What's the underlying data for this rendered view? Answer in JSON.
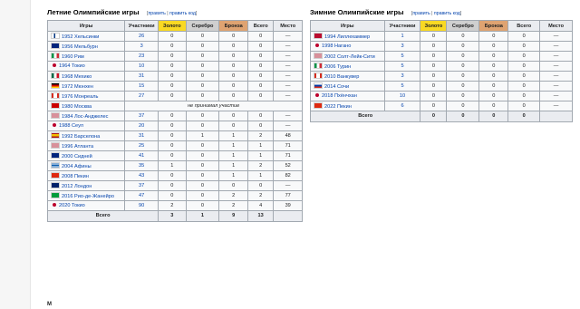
{
  "summer": {
    "title": "Летние Олимпийские игры",
    "edit_open": "[",
    "edit": "править",
    "edit_sep": " | ",
    "edit_code": "править код",
    "edit_close": "]",
    "headers": [
      "Игры",
      "Участники",
      "Золото",
      "Серебро",
      "Бронза",
      "Всего",
      "Место"
    ],
    "rows": [
      {
        "games": "1952 Хельсинки",
        "flag": "fi",
        "part": "26",
        "g": "0",
        "s": "0",
        "b": "0",
        "tot": "0",
        "place": "—"
      },
      {
        "games": "1956 Мельбурн",
        "flag": "au",
        "part": "3",
        "g": "0",
        "s": "0",
        "b": "0",
        "tot": "0",
        "place": "—"
      },
      {
        "games": "1960 Рим",
        "flag": "it",
        "part": "23",
        "g": "0",
        "s": "0",
        "b": "0",
        "tot": "0",
        "place": "—"
      },
      {
        "games": "1964 Токио",
        "flag": "jp",
        "part": "10",
        "g": "0",
        "s": "0",
        "b": "0",
        "tot": "0",
        "place": "—"
      },
      {
        "games": "1968 Мехико",
        "flag": "mx",
        "part": "31",
        "g": "0",
        "s": "0",
        "b": "0",
        "tot": "0",
        "place": "—"
      },
      {
        "games": "1972 Мюнхен",
        "flag": "de",
        "part": "15",
        "g": "0",
        "s": "0",
        "b": "0",
        "tot": "0",
        "place": "—"
      },
      {
        "games": "1976 Монреаль",
        "flag": "ca",
        "part": "27",
        "g": "0",
        "s": "0",
        "b": "0",
        "tot": "0",
        "place": "—"
      },
      {
        "games": "1980 Москва",
        "flag": "su",
        "np": "не принимал участие"
      },
      {
        "games": "1984 Лос-Анджелес",
        "flag": "us",
        "part": "37",
        "g": "0",
        "s": "0",
        "b": "0",
        "tot": "0",
        "place": "—"
      },
      {
        "games": "1988 Сеул",
        "flag": "kr",
        "part": "20",
        "g": "0",
        "s": "0",
        "b": "0",
        "tot": "0",
        "place": "—"
      },
      {
        "games": "1992 Барселона",
        "flag": "es",
        "part": "31",
        "g": "0",
        "s": "1",
        "b": "1",
        "tot": "2",
        "place": "48"
      },
      {
        "games": "1996 Атланта",
        "flag": "us",
        "part": "25",
        "g": "0",
        "s": "0",
        "b": "1",
        "tot": "1",
        "place": "71"
      },
      {
        "games": "2000 Сидней",
        "flag": "au",
        "part": "41",
        "g": "0",
        "s": "0",
        "b": "1",
        "tot": "1",
        "place": "71"
      },
      {
        "games": "2004 Афины",
        "flag": "gr",
        "part": "35",
        "g": "1",
        "s": "0",
        "b": "1",
        "tot": "2",
        "place": "52"
      },
      {
        "games": "2008 Пекин",
        "flag": "cn",
        "part": "43",
        "g": "0",
        "s": "0",
        "b": "1",
        "tot": "1",
        "place": "82"
      },
      {
        "games": "2012 Лондон",
        "flag": "gb",
        "part": "37",
        "g": "0",
        "s": "0",
        "b": "0",
        "tot": "0",
        "place": "—"
      },
      {
        "games": "2016 Рио-де-Жанейро",
        "flag": "br",
        "part": "47",
        "g": "0",
        "s": "0",
        "b": "2",
        "tot": "2",
        "place": "77"
      },
      {
        "games": "2020 Токио",
        "flag": "jp",
        "part": "90",
        "g": "2",
        "s": "0",
        "b": "2",
        "tot": "4",
        "place": "39"
      }
    ],
    "total": {
      "label": "Всего",
      "g": "3",
      "s": "1",
      "b": "9",
      "tot": "13",
      "place": ""
    }
  },
  "winter": {
    "title": "Зимние Олимпийские игры",
    "edit_open": "[",
    "edit": "править",
    "edit_sep": " | ",
    "edit_code": "править код",
    "edit_close": "]",
    "headers": [
      "Игры",
      "Участники",
      "Золото",
      "Серебро",
      "Бронза",
      "Всего",
      "Место"
    ],
    "rows": [
      {
        "games": "1994 Лиллехаммер",
        "flag": "no",
        "part": "1",
        "g": "0",
        "s": "0",
        "b": "0",
        "tot": "0",
        "place": "—"
      },
      {
        "games": "1998 Нагано",
        "flag": "jp",
        "part": "3",
        "g": "0",
        "s": "0",
        "b": "0",
        "tot": "0",
        "place": "—"
      },
      {
        "games": "2002 Солт-Лейк-Сити",
        "flag": "us",
        "part": "5",
        "g": "0",
        "s": "0",
        "b": "0",
        "tot": "0",
        "place": "—"
      },
      {
        "games": "2006 Турин",
        "flag": "it",
        "part": "5",
        "g": "0",
        "s": "0",
        "b": "0",
        "tot": "0",
        "place": "—"
      },
      {
        "games": "2010 Ванкувер",
        "flag": "ca",
        "part": "3",
        "g": "0",
        "s": "0",
        "b": "0",
        "tot": "0",
        "place": "—"
      },
      {
        "games": "2014 Сочи",
        "flag": "ru",
        "part": "5",
        "g": "0",
        "s": "0",
        "b": "0",
        "tot": "0",
        "place": "—"
      },
      {
        "games": "2018 Пхёнчхан",
        "flag": "kr",
        "part": "10",
        "g": "0",
        "s": "0",
        "b": "0",
        "tot": "0",
        "place": "—"
      },
      {
        "games": "2022 Пекин",
        "flag": "cn",
        "part": "6",
        "g": "0",
        "s": "0",
        "b": "0",
        "tot": "0",
        "place": "—"
      }
    ],
    "total": {
      "label": "Всего",
      "g": "0",
      "s": "0",
      "b": "0",
      "tot": "0",
      "place": ""
    }
  },
  "flag_colors": {
    "fi": "linear-gradient(to right, #fff 0 30%, #003580 30% 48%, #fff 48%)",
    "au": "#00247d",
    "it": "linear-gradient(to right, #009246 0 33%, #fff 33% 66%, #ce2b37 66%)",
    "mx": "linear-gradient(to right, #006847 0 33%, #fff 33% 66%, #ce1126 66%)",
    "de": "linear-gradient(#000 0 33%, #dd0000 33% 66%, #ffce00 66%)",
    "ca": "linear-gradient(to right, #d52b1e 0 28%, #fff 28% 72%, #d52b1e 72%)",
    "su": "#cc0000",
    "us": "repeating-linear-gradient(#b22234 0 0.5px, #fff 0.5px 1px)",
    "kr": "#ffffff",
    "es": "linear-gradient(#aa151b 0 25%, #f1bf00 25% 75%, #aa151b 75%)",
    "gr": "repeating-linear-gradient(#0d5eaf 0 0.6px, #fff 0.6px 1.1px)",
    "cn": "#de2910",
    "gb": "#012169",
    "br": "#009c3b",
    "no": "#ba0c2f",
    "ru": "linear-gradient(#fff 0 33%, #0039a6 33% 66%, #d52b1e 66%)"
  },
  "footer": "М"
}
